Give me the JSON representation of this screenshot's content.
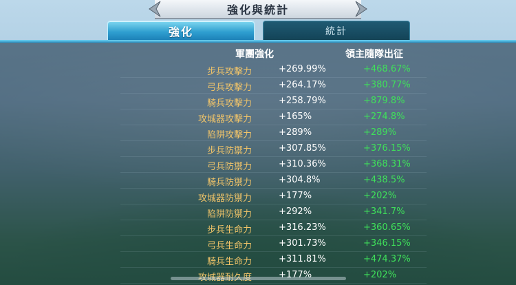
{
  "title": "強化與統計",
  "tabs": [
    {
      "label": "強化",
      "active": true
    },
    {
      "label": "統計",
      "active": false
    }
  ],
  "columns": {
    "army": "軍團強化",
    "lord": "領主隨隊出征"
  },
  "rows": [
    {
      "label": "步兵攻擊力",
      "army": "+269.99%",
      "lord": "+468.67%"
    },
    {
      "label": "弓兵攻擊力",
      "army": "+264.17%",
      "lord": "+380.77%"
    },
    {
      "label": "騎兵攻擊力",
      "army": "+258.79%",
      "lord": "+879.8%"
    },
    {
      "label": "攻城器攻擊力",
      "army": "+165%",
      "lord": "+274.8%"
    },
    {
      "label": "陷阱攻擊力",
      "army": "+289%",
      "lord": "+289%"
    },
    {
      "label": "步兵防禦力",
      "army": "+307.85%",
      "lord": "+376.15%"
    },
    {
      "label": "弓兵防禦力",
      "army": "+310.36%",
      "lord": "+368.31%"
    },
    {
      "label": "騎兵防禦力",
      "army": "+304.8%",
      "lord": "+438.5%"
    },
    {
      "label": "攻城器防禦力",
      "army": "+177%",
      "lord": "+202%"
    },
    {
      "label": "陷阱防禦力",
      "army": "+292%",
      "lord": "+341.7%"
    },
    {
      "label": "步兵生命力",
      "army": "+316.23%",
      "lord": "+360.65%"
    },
    {
      "label": "弓兵生命力",
      "army": "+301.73%",
      "lord": "+346.15%"
    },
    {
      "label": "騎兵生命力",
      "army": "+311.81%",
      "lord": "+474.37%"
    },
    {
      "label": "攻城器耐久度",
      "army": "+177%",
      "lord": "+202%"
    }
  ],
  "colors": {
    "label": "#f1c469",
    "army": "#ffffff",
    "lord": "#3fe05a",
    "accent": "#2f9fd0"
  }
}
